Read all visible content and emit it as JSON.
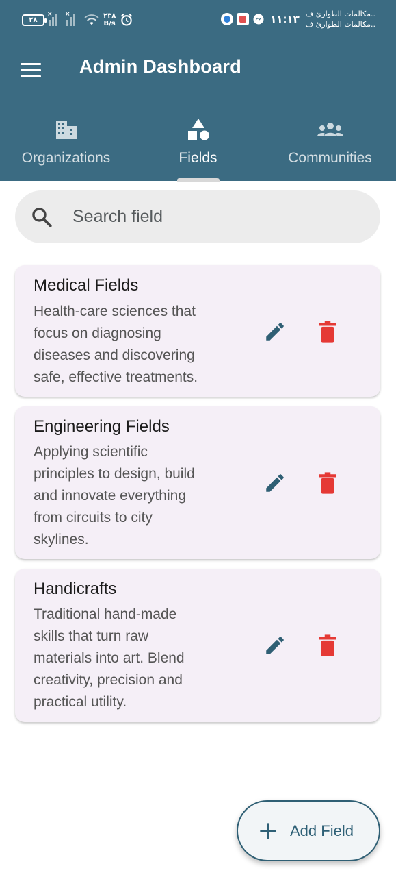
{
  "status_bar": {
    "battery": "٢٨",
    "net_speed_value": "٢٣٨",
    "net_speed_unit": "B/s",
    "time": "١١:١٣",
    "notification_line1": "مكالمات الطوارئ ف..",
    "notification_line2": "مكالمات الطوارئ ف.."
  },
  "app_bar": {
    "title": "Admin Dashboard",
    "menu_icon": "hamburger-menu-icon"
  },
  "tabs": [
    {
      "label": "Organizations",
      "icon": "building-icon",
      "selected": false
    },
    {
      "label": "Fields",
      "icon": "category-shapes-icon",
      "selected": true
    },
    {
      "label": "Communities",
      "icon": "groups-icon",
      "selected": false
    }
  ],
  "search": {
    "placeholder": "Search field",
    "icon": "search-icon"
  },
  "fields": [
    {
      "name": "Medical Fields",
      "description": [
        "Health-care sciences that",
        "focus on diagnosing",
        "diseases and discovering",
        "safe, effective treatments."
      ]
    },
    {
      "name": "Engineering Fields",
      "description": [
        "Applying scientific",
        "principles to design, build",
        "and innovate everything",
        "from circuits to city",
        "skylines."
      ]
    },
    {
      "name": "Handicrafts",
      "description": [
        "Traditional hand-made",
        "skills that turn raw",
        "materials into art. Blend",
        "creativity, precision and",
        "practical utility."
      ]
    }
  ],
  "fab": {
    "label": "Add Field",
    "icon": "plus-icon"
  },
  "colors": {
    "app_bar": "#3b6b82",
    "card_background": "#f5eff7",
    "edit_icon": "#2f5f74",
    "delete_icon": "#e53935",
    "search_background": "#ececec"
  }
}
